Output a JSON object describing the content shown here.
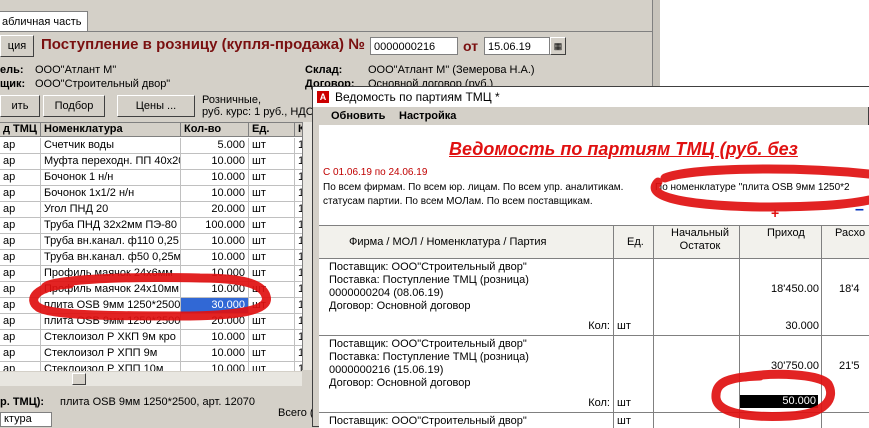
{
  "bg": {
    "tab_label": "абличная часть",
    "toolbar_btn_label": "ция",
    "doc_title": "Поступление в розницу (купля-продажа) №",
    "doc_number": "0000000216",
    "date_label": "от",
    "date_value": "15.06.19",
    "org_label": "ель:",
    "org_value": "ООО\"Атлант М\"",
    "supplier_label": "щик:",
    "supplier_value": "ООО\"Строительный двор\"",
    "warehouse_label": "Склад:",
    "warehouse_value": "ООО\"Атлант М\" (Земерова Н.А.)",
    "contract_label": "Договор:",
    "contract_value": "Основной договор (руб.)",
    "btn_add": "ить",
    "btn_select": "Подбор",
    "btn_prices": "Цены ...",
    "retail_line1": "Розничные,",
    "retail_line2": "руб. курс: 1 руб., НДС",
    "grid_headers": [
      "д ТМЦ",
      "Номенклатура",
      "Кол-во",
      "Ед.",
      "К."
    ],
    "grid_rows": [
      {
        "type": "ар",
        "name": "Счетчик воды",
        "qty": "5.000",
        "unit": "шт",
        "k": "1"
      },
      {
        "type": "ар",
        "name": "Муфта переходн. ПП 40х20",
        "qty": "10.000",
        "unit": "шт",
        "k": "1"
      },
      {
        "type": "ар",
        "name": "Бочонок 1 н/н",
        "qty": "10.000",
        "unit": "шт",
        "k": "1"
      },
      {
        "type": "ар",
        "name": "Бочонок 1х1/2 н/н",
        "qty": "10.000",
        "unit": "шт",
        "k": "1"
      },
      {
        "type": "ар",
        "name": "Угол ПНД 20",
        "qty": "20.000",
        "unit": "шт",
        "k": "1"
      },
      {
        "type": "ар",
        "name": "Труба ПНД 32х2мм ПЭ-80",
        "qty": "100.000",
        "unit": "шт",
        "k": "1"
      },
      {
        "type": "ар",
        "name": "Труба вн.канал. ф110 0,25",
        "qty": "10.000",
        "unit": "шт",
        "k": "1"
      },
      {
        "type": "ар",
        "name": "Труба вн.канал. ф50 0,25м",
        "qty": "10.000",
        "unit": "шт",
        "k": "1"
      },
      {
        "type": "ар",
        "name": "Профиль маячок 24х6мм",
        "qty": "10.000",
        "unit": "шт",
        "k": "1"
      },
      {
        "type": "ар",
        "name": "Профиль маячок 24х10мм",
        "qty": "10.000",
        "unit": "шт",
        "k": "1"
      },
      {
        "type": "ар",
        "name": "плита OSB 9мм 1250*2500",
        "qty": "30.000",
        "unit": "шт",
        "k": "1"
      },
      {
        "type": "ар",
        "name": "плита OSB 9мм 1250*2500",
        "qty": "20.000",
        "unit": "шт",
        "k": "1"
      },
      {
        "type": "ар",
        "name": "Стеклоизол Р ХКП 9м кро",
        "qty": "10.000",
        "unit": "шт",
        "k": "1"
      },
      {
        "type": "ар",
        "name": "Стеклоизол Р ХПП 9м",
        "qty": "10.000",
        "unit": "шт",
        "k": "1"
      },
      {
        "type": "ар",
        "name": "Стеклоизол Р ХПП 10м",
        "qty": "10.000",
        "unit": "шт",
        "k": "1"
      }
    ],
    "footer_label": "р. ТМЦ):",
    "footer_value": "плита OSB 9мм 1250*2500, арт. 12070",
    "total_label": "Всего (",
    "bottom_tab": "ктура"
  },
  "fg": {
    "title": "Ведомость по партиям ТМЦ  *",
    "menu": [
      "Обновить",
      "Настройка"
    ],
    "report_title": "Ведомость по партиям ТМЦ (руб. без",
    "period": "С 01.06.19 по 24.06.19",
    "filter1": "По всем фирмам. По всем юр. лицам. По всем упр. аналитикам.",
    "filter2": "статусам партии. По всем МОЛам. По всем поставщикам.",
    "filter3": "По номенклатуре \"плита OSB 9мм 1250*2",
    "plus_sign": "+",
    "minus_sign": "–",
    "col_main": "Фирма / МОЛ / Номенклатура / Партия",
    "col_unit": "Ед.",
    "col_open1": "Начальный",
    "col_open2": "Остаток",
    "col_in": "Приход",
    "col_out": "Расхо",
    "block1": {
      "l1": "Поставщик: ООО\"Строительный двор\"",
      "l2": "Поставка: Поступление ТМЦ (розница)",
      "l3": "0000000204 (08.06.19)",
      "l4": "Договор: Основной договор",
      "kol": "Кол:",
      "unit": "шт",
      "in_sum": "18'450.00",
      "out_sum": "18'4",
      "in_qty": "30.000"
    },
    "block2": {
      "l1": "Поставщик: ООО\"Строительный двор\"",
      "l2": "Поставка: Поступление ТМЦ (розница)",
      "l3": "0000000216 (15.06.19)",
      "l4": "Договор: Основной договор",
      "kol": "Кол:",
      "unit": "шт",
      "in_sum": "30'750.00",
      "out_sum": "21'5",
      "in_qty": "50.000"
    },
    "block3": {
      "l1": "Поставщик: ООО\"Строительный двор\"",
      "unit": "шт"
    }
  },
  "colors": {
    "title_red": "#7a1010",
    "report_red": "#e01010",
    "marker": "#e01010",
    "selection": "#3168d5"
  }
}
